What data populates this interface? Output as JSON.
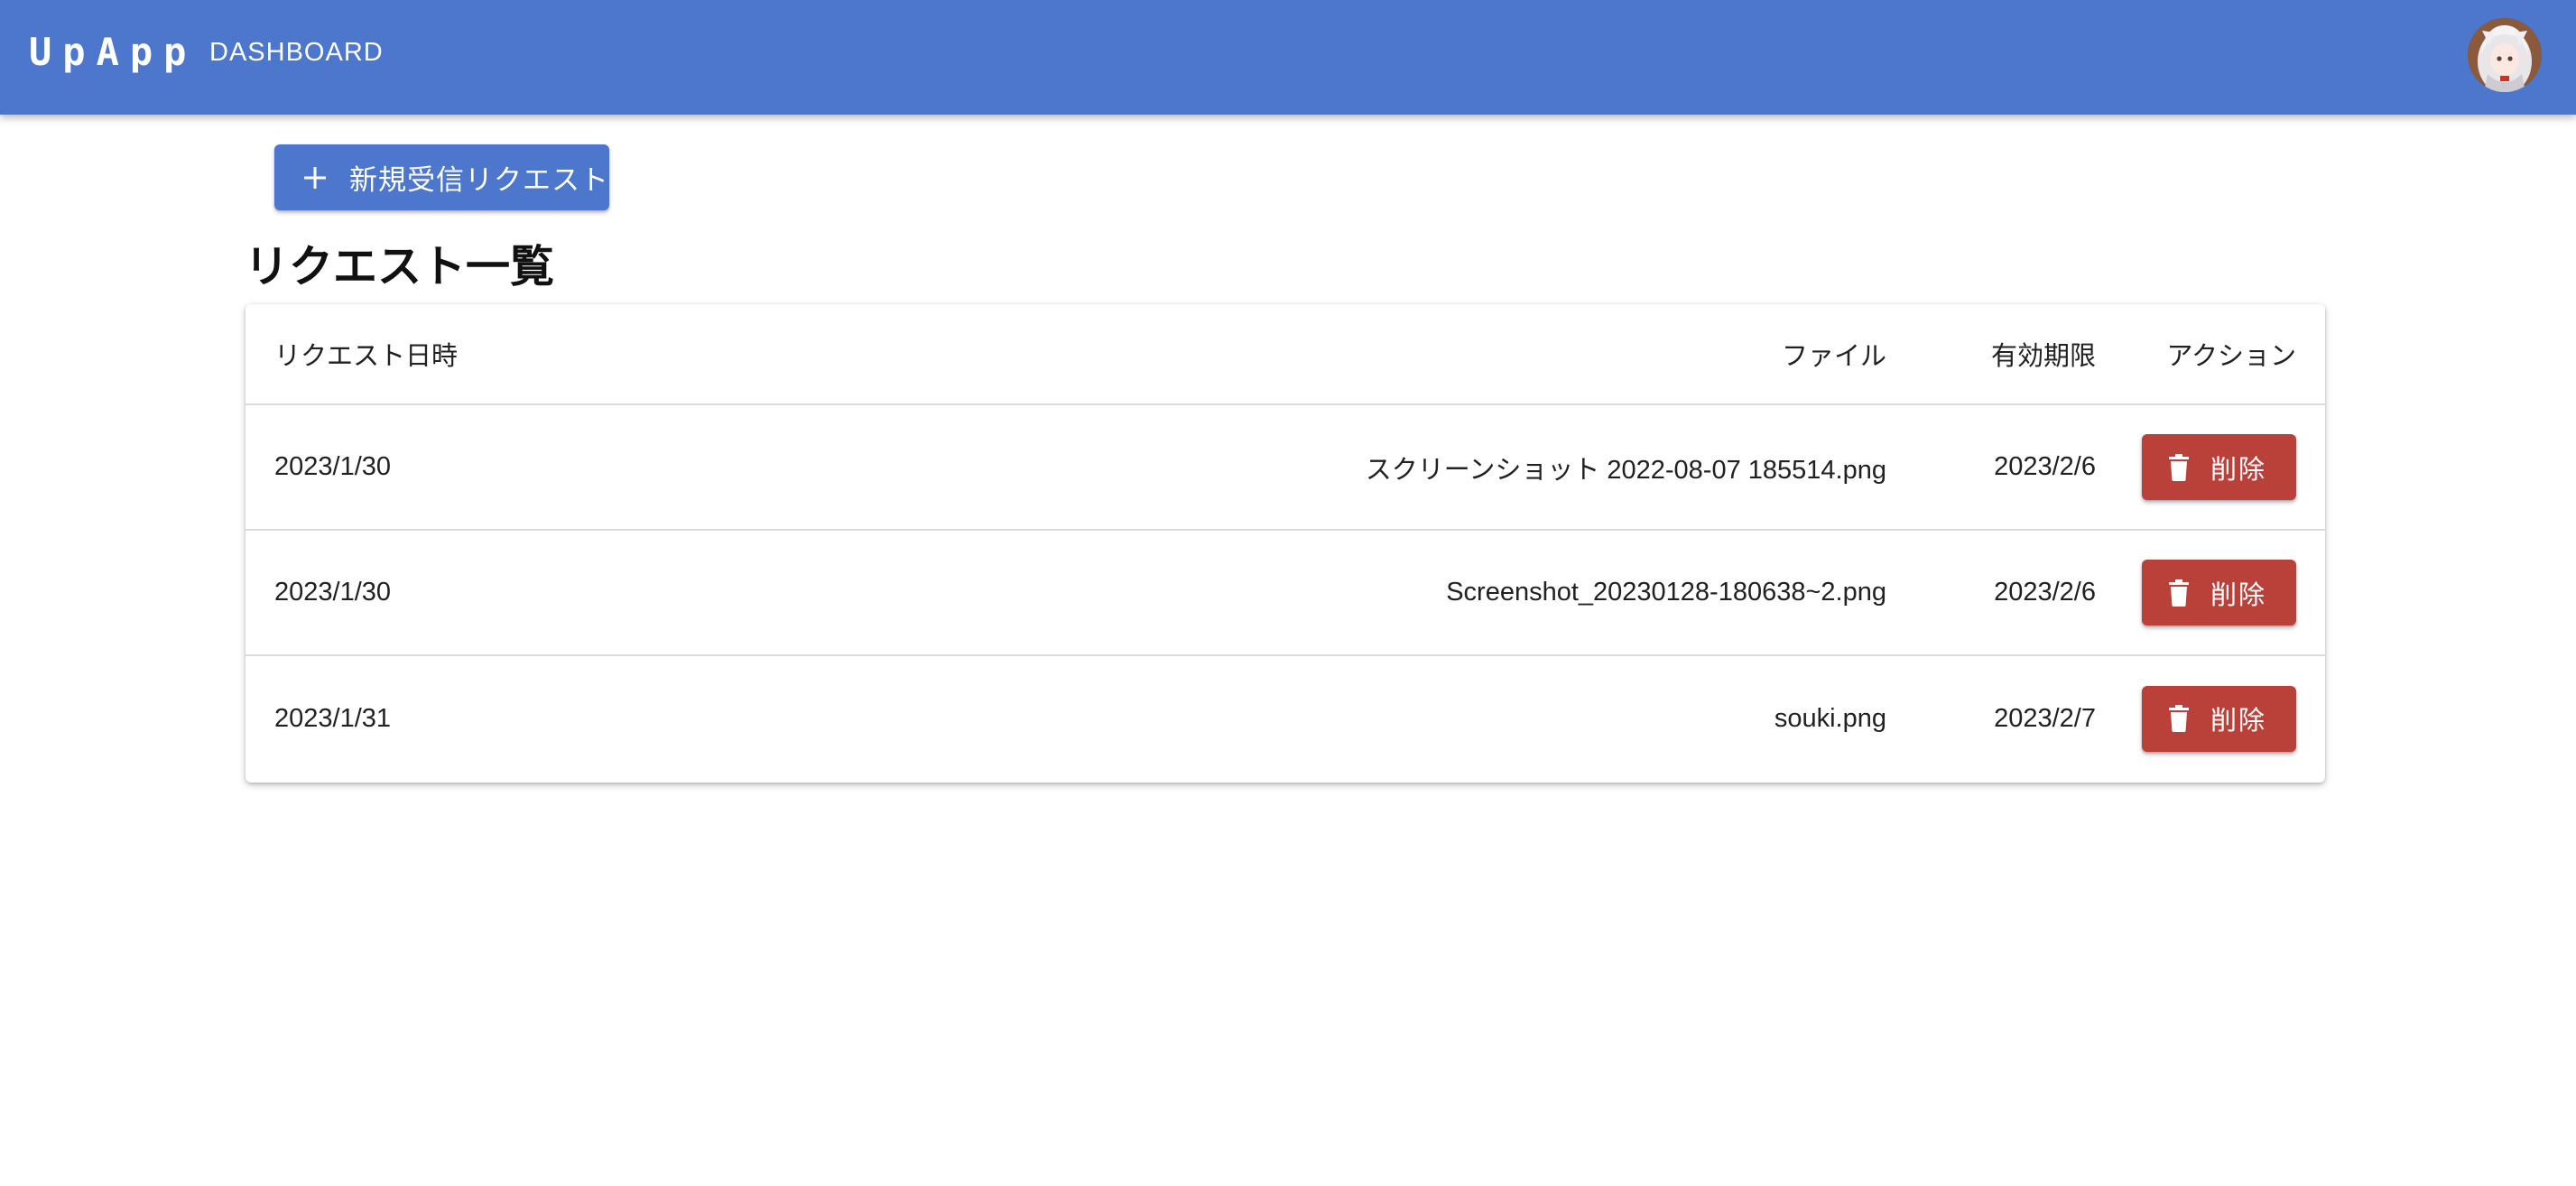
{
  "appbar": {
    "brand": "UpApp",
    "nav_dashboard": "DASHBOARD",
    "avatar_icon": "user-avatar-icon",
    "background_color": "#4c77cd"
  },
  "toolbar": {
    "new_request_label": "新規受信リクエスト",
    "new_request_icon": "plus-icon"
  },
  "page": {
    "title": "リクエスト一覧"
  },
  "table": {
    "headers": {
      "date": "リクエスト日時",
      "file": "ファイル",
      "expiry": "有効期限",
      "action": "アクション"
    },
    "rows": [
      {
        "date": "2023/1/30",
        "file": "スクリーンショット 2022-08-07 185514.png",
        "expiry": "2023/2/6",
        "action_label": "削除"
      },
      {
        "date": "2023/1/30",
        "file": "Screenshot_20230128-180638~2.png",
        "expiry": "2023/2/6",
        "action_label": "削除"
      },
      {
        "date": "2023/1/31",
        "file": "souki.png",
        "expiry": "2023/2/7",
        "action_label": "削除"
      }
    ],
    "delete_icon": "trash-icon",
    "delete_color": "#b9413a"
  }
}
